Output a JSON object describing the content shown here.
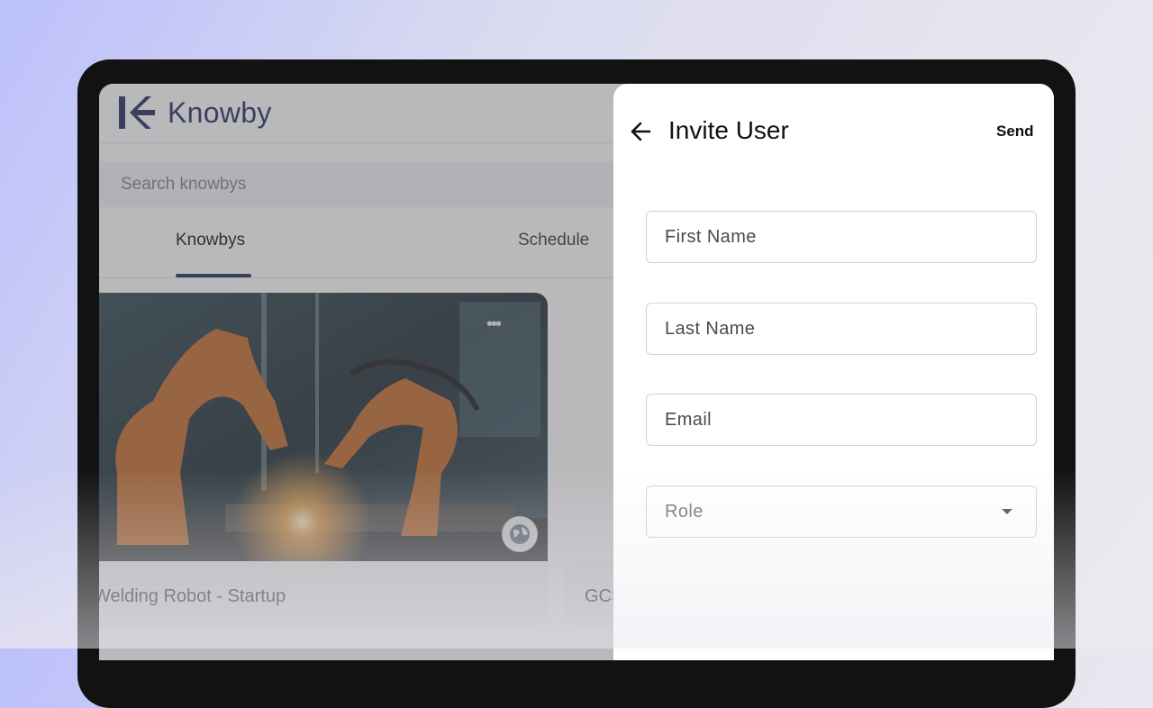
{
  "app": {
    "logo_text": "Knowby",
    "search": {
      "placeholder": "Search knowbys"
    },
    "tabs": [
      {
        "label": "Knowbys",
        "active": true
      },
      {
        "label": "Schedule",
        "active": false
      }
    ],
    "cards": [
      {
        "title": "Welding Robot - Startup"
      },
      {
        "title": "GCS"
      }
    ]
  },
  "invite_panel": {
    "title": "Invite User",
    "send_label": "Send",
    "fields": {
      "first_name": {
        "placeholder": "First Name"
      },
      "last_name": {
        "placeholder": "Last Name"
      },
      "email": {
        "placeholder": "Email"
      },
      "role": {
        "placeholder": "Role"
      }
    }
  },
  "colors": {
    "brand_navy": "#1e2a5a",
    "scrim": "#5f5f64"
  },
  "icons": [
    "knowby-logo-icon",
    "more-options-icon",
    "globe-icon",
    "arrow-back-icon",
    "dropdown-caret-icon"
  ]
}
